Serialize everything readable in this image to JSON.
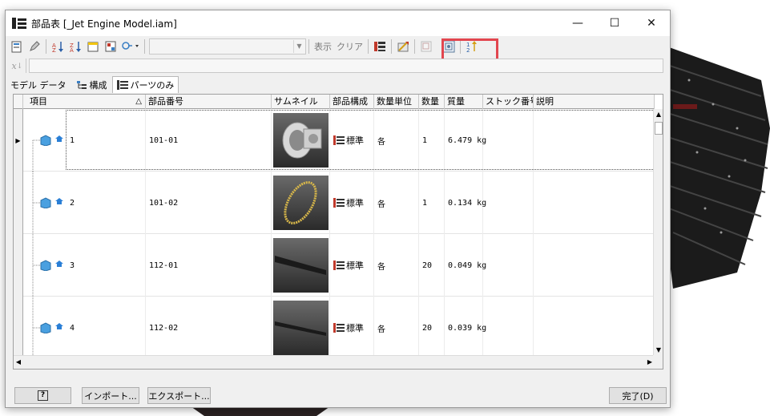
{
  "window": {
    "title": "部品表 [_Jet Engine Model.iam]"
  },
  "title_buttons": {
    "minimize": "—",
    "maximize": "☐",
    "close": "✕"
  },
  "toolbar": {
    "show_label": "表示",
    "clear_label": "クリア"
  },
  "tabs": [
    {
      "label": "モデル データ"
    },
    {
      "label": "構成"
    },
    {
      "label": "パーツのみ"
    }
  ],
  "table": {
    "columns": [
      "項目",
      "部品番号",
      "サムネイル",
      "部品構成",
      "数量単位",
      "数量",
      "質量",
      "ストック番号",
      "説明"
    ],
    "sort_indicator": "△",
    "rows": [
      {
        "item": "1",
        "part_number": "101-01",
        "structure": "標準",
        "unit": "各",
        "qty": "1",
        "mass": "6.479 kg"
      },
      {
        "item": "2",
        "part_number": "101-02",
        "structure": "標準",
        "unit": "各",
        "qty": "1",
        "mass": "0.134 kg"
      },
      {
        "item": "3",
        "part_number": "112-01",
        "structure": "標準",
        "unit": "各",
        "qty": "20",
        "mass": "0.049 kg"
      },
      {
        "item": "4",
        "part_number": "112-02",
        "structure": "標準",
        "unit": "各",
        "qty": "20",
        "mass": "0.039 kg"
      }
    ]
  },
  "footer": {
    "help": "?",
    "import": "インポート...",
    "export": "エクスポート...",
    "done": "完了(D)"
  },
  "colors": {
    "highlight": "#e2464f",
    "accent_blue": "#2a8fd6"
  }
}
